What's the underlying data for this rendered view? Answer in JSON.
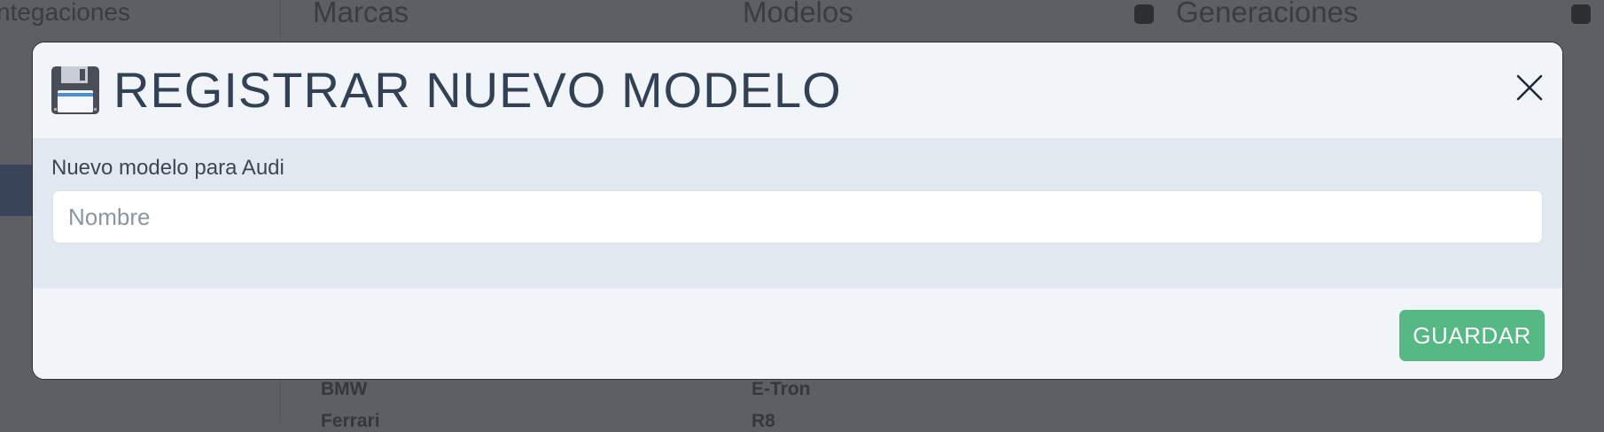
{
  "background": {
    "top_tabs": [
      "Marcas",
      "Modelos",
      "Generaciones"
    ],
    "top_left_label": "ntegaciones",
    "table_rows": [
      {
        "brand": "BMW",
        "model": "E-Tron"
      },
      {
        "brand": "Ferrari",
        "model": "R8"
      }
    ]
  },
  "modal": {
    "icon": "floppy-disk-icon",
    "title": "REGISTRAR NUEVO MODELO",
    "field_label": "Nuevo modelo para Audi",
    "input_value": "",
    "input_placeholder": "Nombre",
    "save_label": "GUARDAR"
  },
  "colors": {
    "accent": "#55b885",
    "modal_bg": "#f1f5f9",
    "body_bg": "#e2e8f0",
    "title": "#334155",
    "overlay": "#5d5f64"
  }
}
